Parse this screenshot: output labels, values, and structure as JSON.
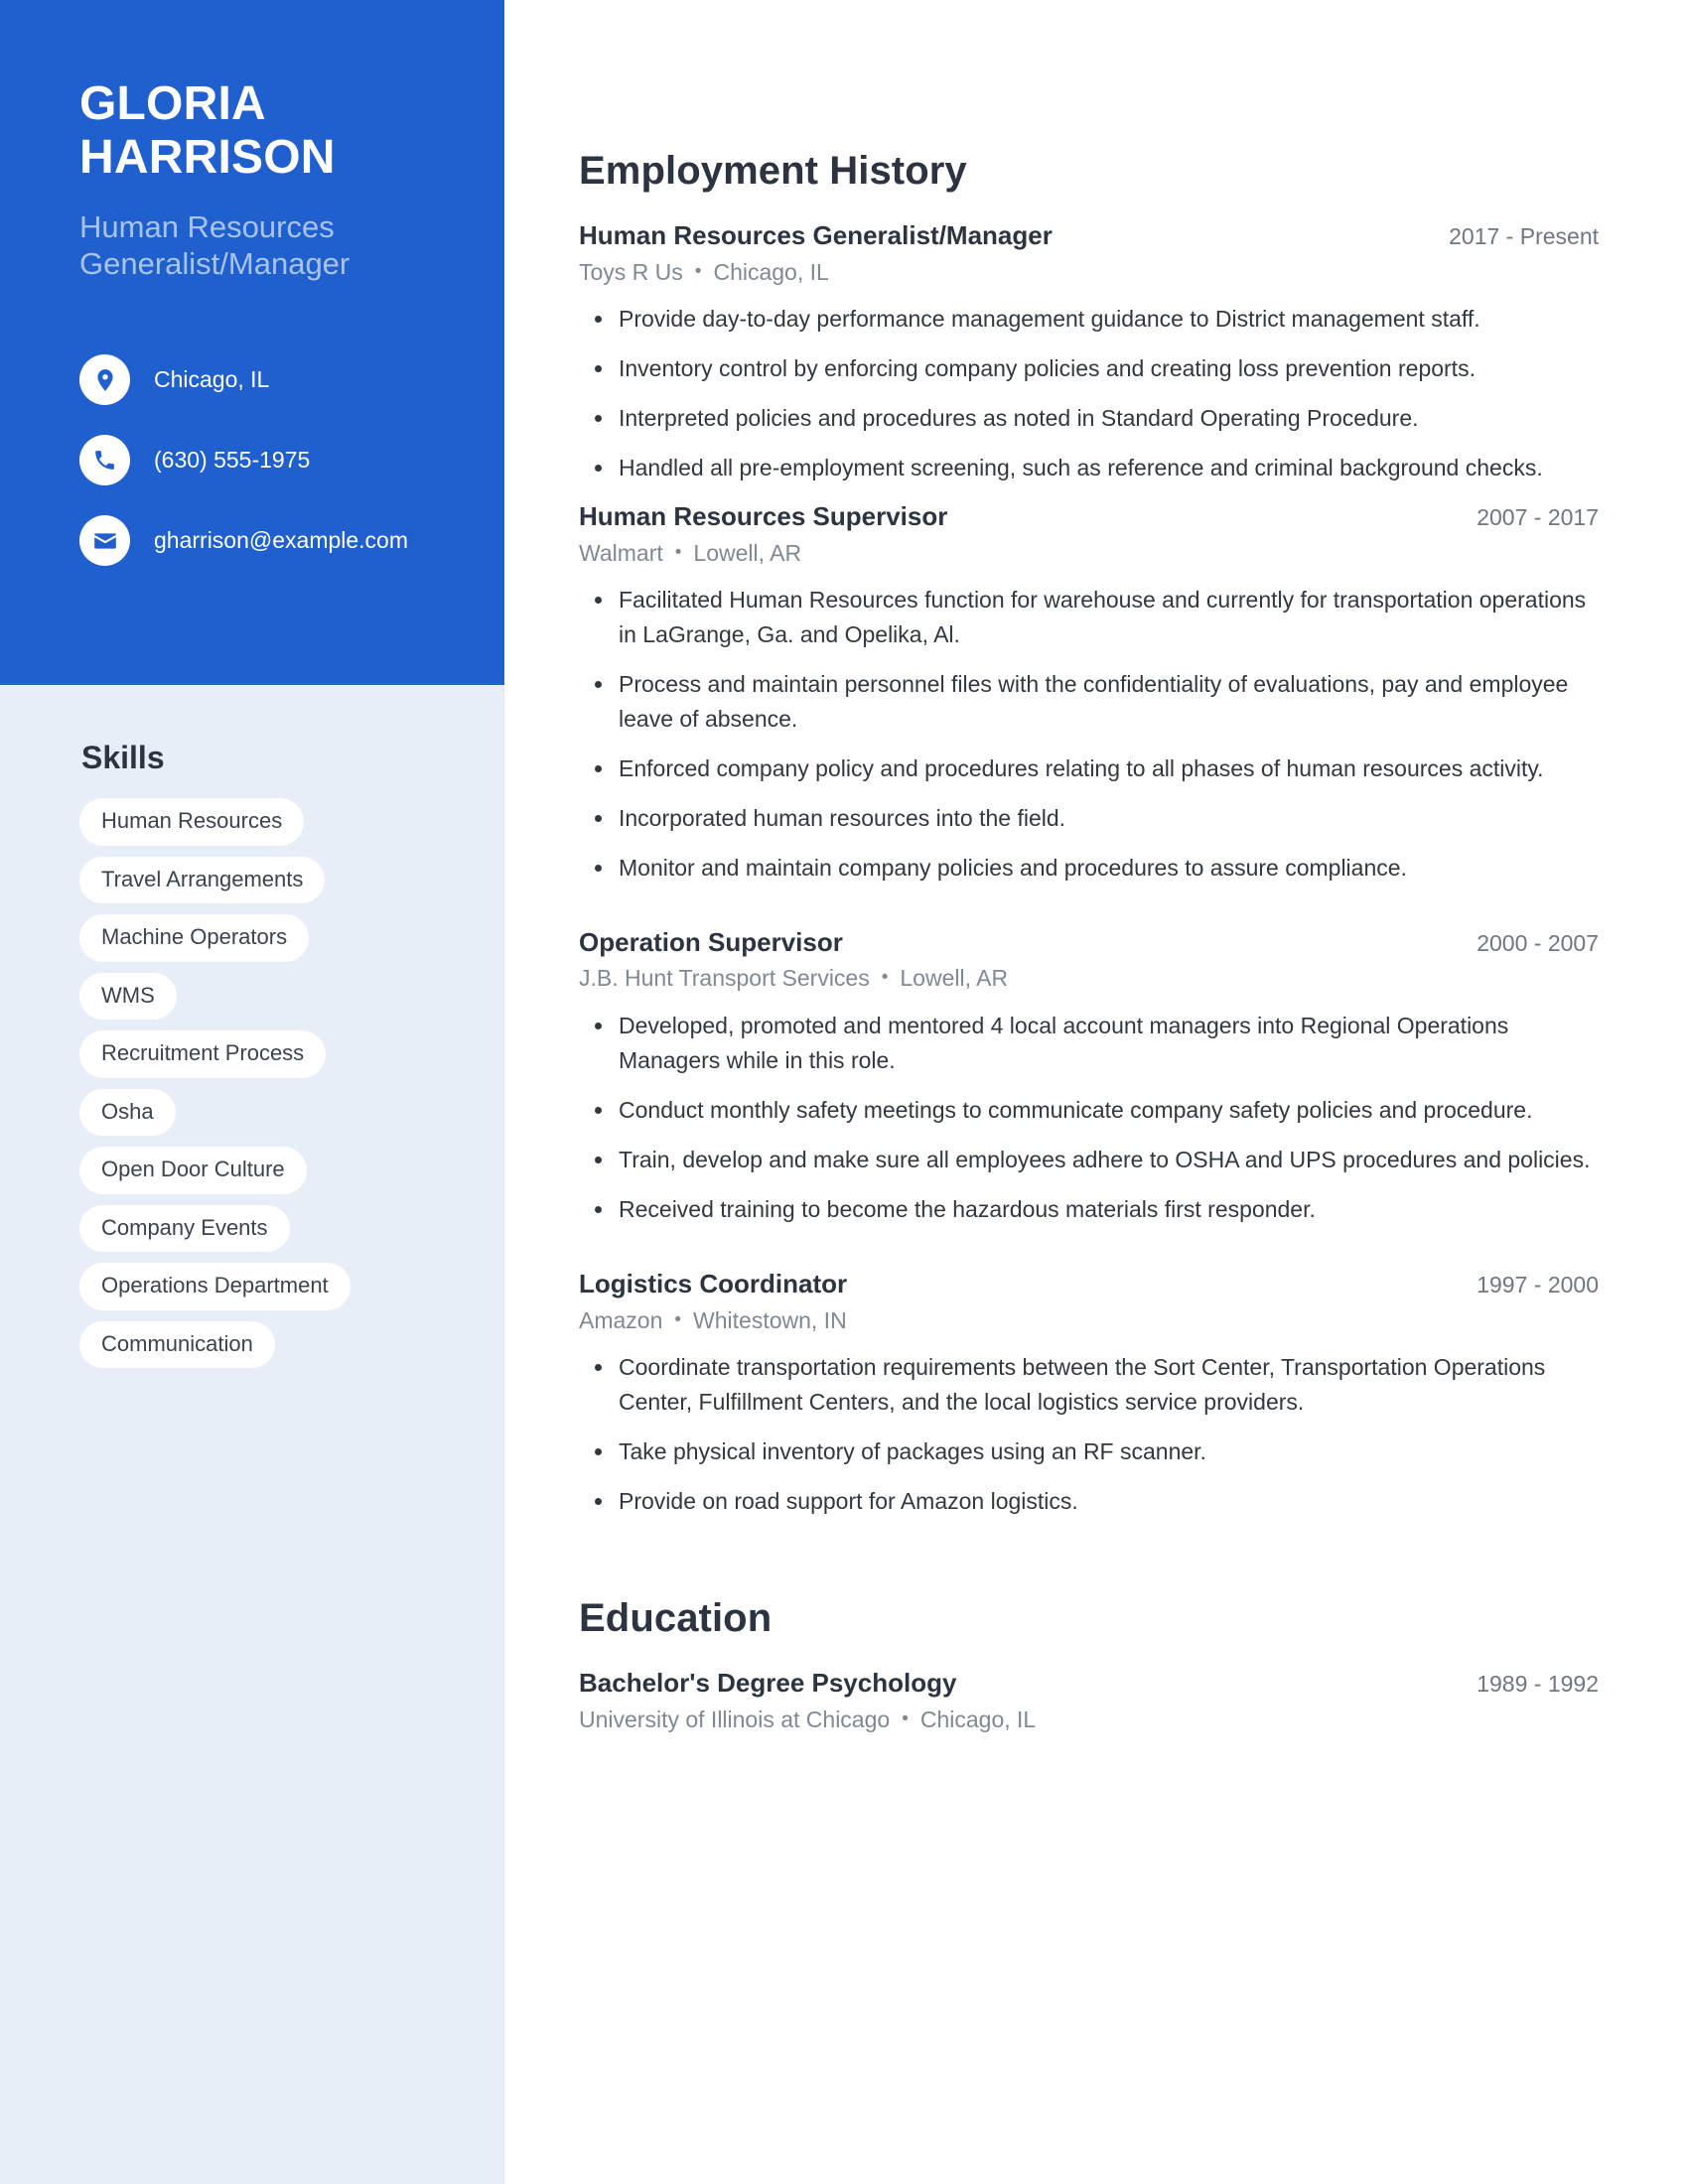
{
  "colors": {
    "accent": "#1F5FCE",
    "sidebar_bg": "#E8EEF8",
    "subtitle": "#A7C3EE",
    "pill_bg": "#FFFFFF",
    "text_dark": "#2B3440",
    "text_muted": "#808892"
  },
  "profile": {
    "first_name": "GLORIA",
    "last_name": "HARRISON",
    "job_title": "Human Resources Generalist/Manager"
  },
  "contact": [
    {
      "icon": "location-pin-icon",
      "label": "Chicago, IL"
    },
    {
      "icon": "phone-icon",
      "label": "(630) 555-1975"
    },
    {
      "icon": "envelope-icon",
      "label": "gharrison@example.com"
    }
  ],
  "skills": {
    "heading": "Skills",
    "items": [
      "Human Resources",
      "Travel Arrangements",
      "Machine Operators",
      "WMS",
      "Recruitment Process",
      "Osha",
      "Open Door Culture",
      "Company Events",
      "Operations Department",
      "Communication"
    ]
  },
  "employment": {
    "heading": "Employment History",
    "separator": "•",
    "entries": [
      {
        "title": "Human Resources Generalist/Manager",
        "dates": "2017 - Present",
        "company": "Toys R Us",
        "location": "Chicago, IL",
        "bullets": [
          "Provide day-to-day performance management guidance to District management staff.",
          "Inventory control by enforcing company policies and creating loss prevention reports.",
          "Interpreted policies and procedures as noted in Standard Operating Procedure.",
          "Handled all pre-employment screening, such as reference and criminal background checks."
        ]
      },
      {
        "title": "Human Resources Supervisor",
        "dates": "2007 - 2017",
        "company": "Walmart",
        "location": "Lowell, AR",
        "bullets": [
          "Facilitated Human Resources function for warehouse and currently for transportation operations in LaGrange, Ga. and Opelika, Al.",
          "Process and maintain personnel files with the confidentiality of evaluations, pay and employee leave of absence.",
          "Enforced company policy and procedures relating to all phases of human resources activity.",
          "Incorporated human resources into the field.",
          "Monitor and maintain company policies and procedures to assure compliance."
        ]
      },
      {
        "title": "Operation Supervisor",
        "dates": "2000 - 2007",
        "company": "J.B. Hunt Transport Services",
        "location": "Lowell, AR",
        "bullets": [
          "Developed, promoted and mentored 4 local account managers into Regional Operations Managers while in this role.",
          "Conduct monthly safety meetings to communicate company safety policies and procedure.",
          "Train, develop and make sure all employees adhere to OSHA and UPS procedures and policies.",
          "Received training to become the hazardous materials first responder."
        ]
      },
      {
        "title": "Logistics Coordinator",
        "dates": "1997 - 2000",
        "company": "Amazon",
        "location": "Whitestown, IN",
        "bullets": [
          "Coordinate transportation requirements between the Sort Center, Transportation Operations Center, Fulfillment Centers, and the local logistics service providers.",
          "Take physical inventory of packages using an RF scanner.",
          "Provide on road support for Amazon logistics."
        ]
      }
    ]
  },
  "education": {
    "heading": "Education",
    "separator": "•",
    "entries": [
      {
        "title": "Bachelor's Degree Psychology",
        "dates": "1989 - 1992",
        "school": "University of Illinois at Chicago",
        "location": "Chicago, IL"
      }
    ]
  }
}
